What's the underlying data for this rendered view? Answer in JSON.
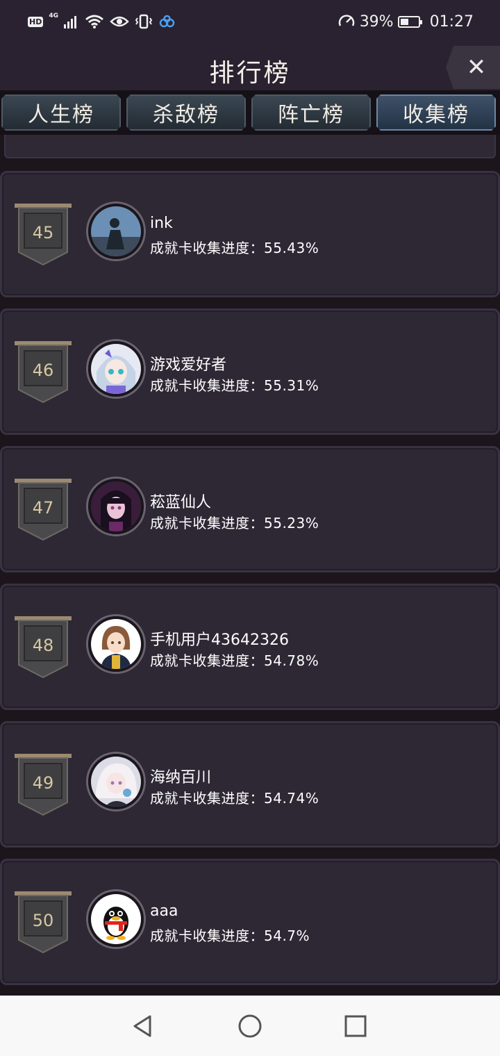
{
  "status_bar": {
    "hd": "HD",
    "network": "4G",
    "battery_percent": "39%",
    "time": "01:27",
    "icons": [
      "signal-icon",
      "wifi-icon",
      "eye-icon",
      "vibrate-icon",
      "cloud-icon",
      "speedometer-icon",
      "battery-icon"
    ]
  },
  "header": {
    "title": "排行榜",
    "close_icon": "close-icon"
  },
  "tabs": [
    {
      "label": "人生榜",
      "active": false
    },
    {
      "label": "杀敌榜",
      "active": false
    },
    {
      "label": "阵亡榜",
      "active": false
    },
    {
      "label": "收集榜",
      "active": true
    }
  ],
  "entries": [
    {
      "rank": "45",
      "name": "ink",
      "progress": "成就卡收集进度：55.43%",
      "avatar": "photo-avatar"
    },
    {
      "rank": "46",
      "name": "游戏爱好者",
      "progress": "成就卡收集进度：55.31%",
      "avatar": "anime-girl-avatar"
    },
    {
      "rank": "47",
      "name": "菘蓝仙人",
      "progress": "成就卡收集进度：55.23%",
      "avatar": "purple-girl-avatar"
    },
    {
      "rank": "48",
      "name": "手机用户43642326",
      "progress": "成就卡收集进度：54.78%",
      "avatar": "uniform-girl-avatar"
    },
    {
      "rank": "49",
      "name": "海纳百川",
      "progress": "成就卡收集进度：54.74%",
      "avatar": "white-hair-avatar"
    },
    {
      "rank": "50",
      "name": "aaa",
      "progress": "成就卡收集进度：54.7%",
      "avatar": "qq-penguin-avatar"
    }
  ],
  "nav_bar": {
    "icons": [
      "back-icon",
      "home-icon",
      "recents-icon"
    ]
  },
  "colors": {
    "background": "#1f1820",
    "card": "#2e2835",
    "tab_active": "#3e5168",
    "rank_text": "#d8c8a0"
  }
}
